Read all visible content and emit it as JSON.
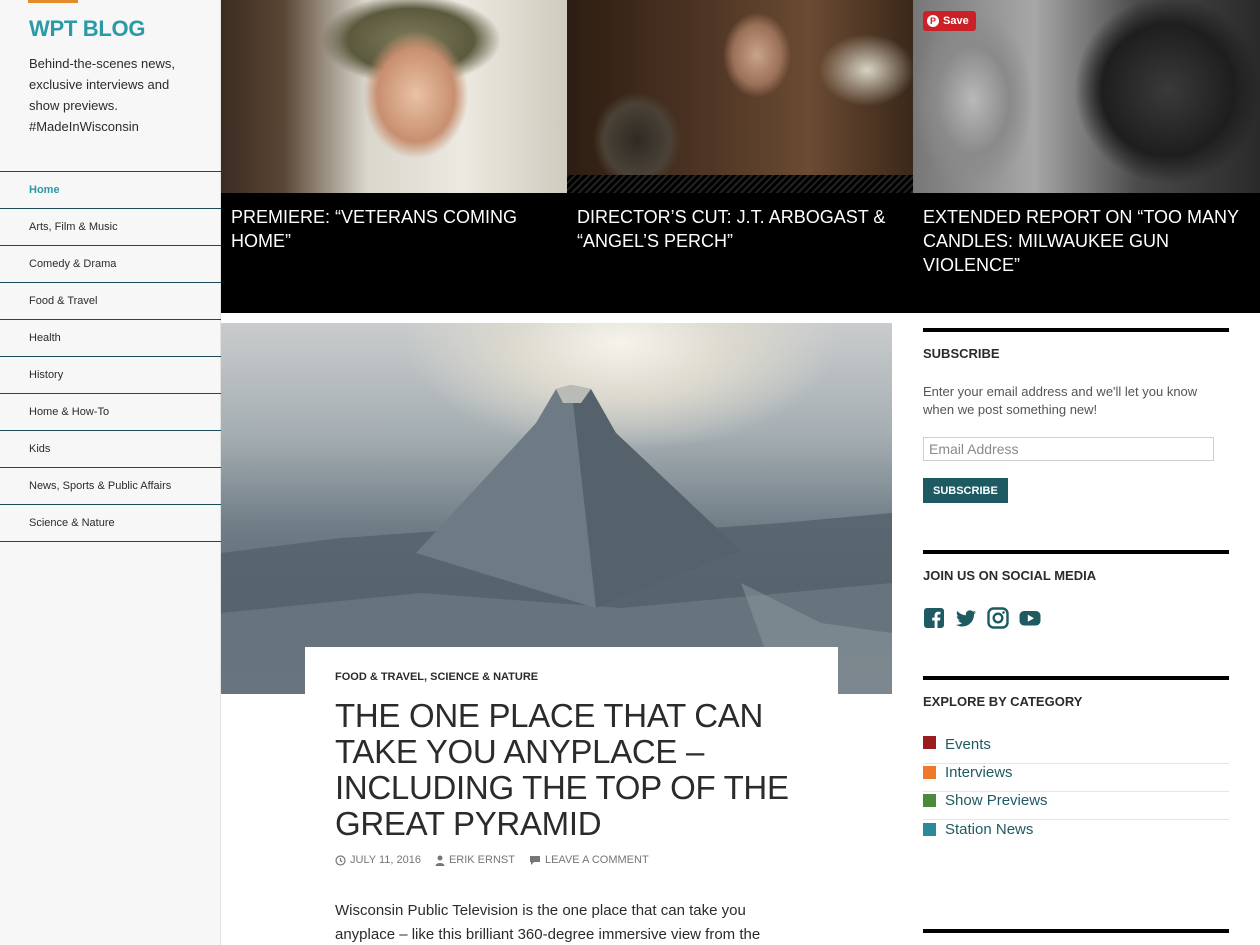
{
  "site": {
    "title": "WPT BLOG",
    "description": "Behind-the-scenes news, exclusive interviews and show previews. #MadeInWisconsin"
  },
  "nav": {
    "items": [
      {
        "label": "Home",
        "active": true
      },
      {
        "label": "Arts, Film & Music"
      },
      {
        "label": "Comedy & Drama"
      },
      {
        "label": "Food & Travel"
      },
      {
        "label": "Health"
      },
      {
        "label": "History"
      },
      {
        "label": "Home & How-To"
      },
      {
        "label": "Kids"
      },
      {
        "label": "News, Sports & Public Affairs"
      },
      {
        "label": "Science & Nature"
      }
    ]
  },
  "featured": [
    {
      "title": "PREMIERE: “VETERANS COMING HOME”"
    },
    {
      "title": "DIRECTOR’S CUT: J.T. ARBOGAST & “ANGEL’S PERCH”"
    },
    {
      "title": "EXTENDED REPORT ON “TOO MANY CANDLES: MILWAUKEE GUN VIOLENCE”",
      "pin_label": "Save"
    }
  ],
  "post": {
    "categories": [
      "FOOD & TRAVEL",
      "SCIENCE & NATURE"
    ],
    "category_separator": ", ",
    "title": "THE ONE PLACE THAT CAN TAKE YOU ANYPLACE – INCLUDING THE TOP OF THE GREAT PYRAMID",
    "date": "JULY 11, 2016",
    "author": "ERIK ERNST",
    "comment_link": "LEAVE A COMMENT",
    "excerpt": "Wisconsin Public Television is the one place that can take you anyplace – like this brilliant 360-degree immersive view from the"
  },
  "widgets": {
    "subscribe": {
      "heading": "SUBSCRIBE",
      "text": "Enter your email address and we'll let you know when we post something new!",
      "email_placeholder": "Email Address",
      "button_label": "SUBSCRIBE"
    },
    "social": {
      "heading": "JOIN US ON SOCIAL MEDIA",
      "icons": [
        "facebook-icon",
        "twitter-icon",
        "instagram-icon",
        "youtube-icon"
      ],
      "color": "#1e5a62"
    },
    "categories": {
      "heading": "EXPLORE BY CATEGORY",
      "items": [
        {
          "label": "Events",
          "color": "#9b1b1f"
        },
        {
          "label": "Interviews",
          "color": "#f0782a"
        },
        {
          "label": "Show Previews",
          "color": "#4a8a3a"
        },
        {
          "label": "Station News",
          "color": "#2a8a9a"
        }
      ]
    }
  },
  "colors": {
    "accent": "#2a9aa7",
    "button": "#1e5a62",
    "pinterest": "#cb2027"
  }
}
